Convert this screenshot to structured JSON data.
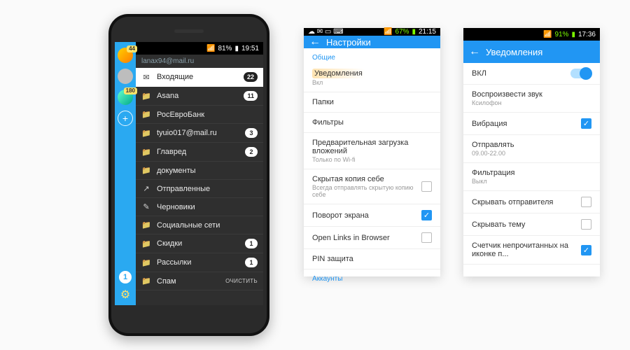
{
  "phone1": {
    "status": {
      "battery_pct": "81%",
      "time": "19:51"
    },
    "account_email": "lanax94@mail.ru",
    "rail": {
      "avatars": [
        {
          "kind": "a1",
          "badge": "44"
        },
        {
          "kind": "a2",
          "badge": ""
        },
        {
          "kind": "a3",
          "badge": "180"
        }
      ],
      "compose_glyph": "+",
      "bottom_badge": "1",
      "gear_glyph": "⚙"
    },
    "nav": [
      {
        "icon": "✉",
        "label": "Входящие",
        "badge": "22",
        "selected": true
      },
      {
        "icon": "📁",
        "label": "Asana",
        "badge": "11"
      },
      {
        "icon": "📁",
        "label": "РосЕвроБанк",
        "badge": ""
      },
      {
        "icon": "📁",
        "label": "tyuio017@mail.ru",
        "badge": "3"
      },
      {
        "icon": "📁",
        "label": "Главред",
        "badge": "2"
      },
      {
        "icon": "📁",
        "label": "документы",
        "badge": ""
      },
      {
        "icon": "↗",
        "label": "Отправленные",
        "badge": ""
      },
      {
        "icon": "✎",
        "label": "Черновики",
        "badge": ""
      },
      {
        "icon": "📁",
        "label": "Социальные сети",
        "badge": ""
      },
      {
        "icon": "📁",
        "label": "Скидки",
        "badge": "1"
      },
      {
        "icon": "📁",
        "label": "Рассылки",
        "badge": "1"
      },
      {
        "icon": "📁",
        "label": "Спам",
        "badge": "",
        "clear": "ОЧИСТИТЬ"
      }
    ]
  },
  "phone2": {
    "status": {
      "battery_pct": "67%",
      "time": "21:15"
    },
    "title": "Настройки",
    "section_general": "Общие",
    "rows": [
      {
        "title": "Уведомления",
        "sub": "Вкл",
        "highlight": true
      },
      {
        "title": "Папки"
      },
      {
        "title": "Фильтры"
      },
      {
        "title": "Предварительная загрузка вложений",
        "sub": "Только по Wi-fi"
      },
      {
        "title": "Скрытая копия себе",
        "sub": "Всегда отправлять скрытую копию себе",
        "checkbox": false
      },
      {
        "title": "Поворот экрана",
        "checkbox": true
      },
      {
        "title": "Open Links in Browser",
        "checkbox": false
      },
      {
        "title": "PIN защита"
      }
    ],
    "section_accounts": "Аккаунты"
  },
  "phone3": {
    "status": {
      "battery_pct": "91%",
      "time": "17:36"
    },
    "title": "Уведомления",
    "master": {
      "label": "ВКЛ",
      "on": true
    },
    "rows": [
      {
        "title": "Воспроизвести звук",
        "sub": "Ксилофон"
      },
      {
        "title": "Вибрация",
        "checkbox": true
      },
      {
        "title": "Отправлять",
        "sub": "09.00-22.00"
      },
      {
        "title": "Фильтрация",
        "sub": "Выкл"
      },
      {
        "title": "Скрывать отправителя",
        "checkbox": false
      },
      {
        "title": "Скрывать тему",
        "checkbox": false
      },
      {
        "title": "Счетчик непрочитанных на иконке п...",
        "checkbox": true
      }
    ]
  }
}
